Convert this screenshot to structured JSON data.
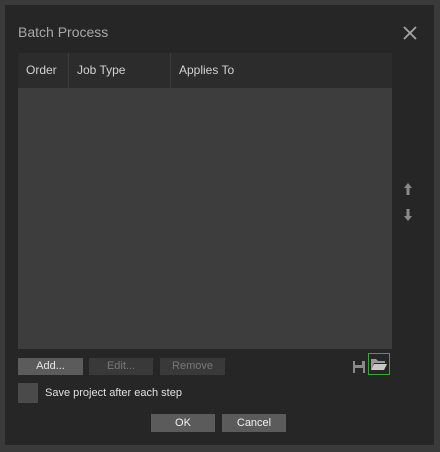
{
  "dialog": {
    "title": "Batch Process"
  },
  "table": {
    "columns": [
      "Order",
      "Job Type",
      "Applies To"
    ],
    "rows": []
  },
  "icons": {
    "close": "close-icon",
    "move_up": "arrow-up-icon",
    "move_down": "arrow-down-icon",
    "save": "save-icon",
    "open": "folder-open-icon"
  },
  "toolbar": {
    "add_label": "Add...",
    "edit_label": "Edit...",
    "remove_label": "Remove"
  },
  "options": {
    "save_after_step_label": "Save project after each step",
    "save_after_step_checked": false
  },
  "footer": {
    "ok_label": "OK",
    "cancel_label": "Cancel"
  },
  "colors": {
    "background": "#262626",
    "table_body": "#3d3d3d",
    "highlight_border": "#3aa53a"
  }
}
